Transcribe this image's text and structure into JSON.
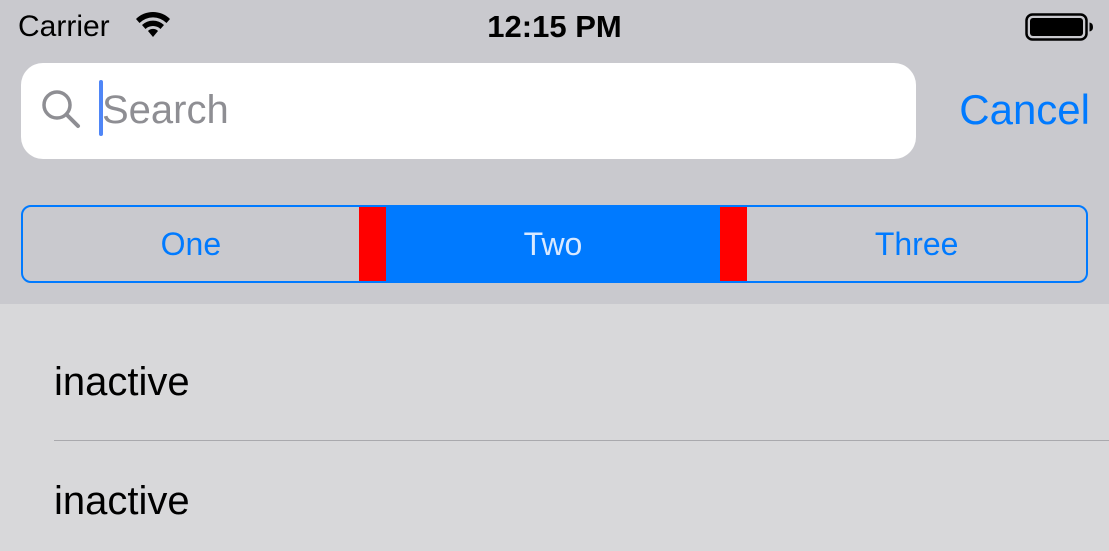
{
  "status_bar": {
    "carrier": "Carrier",
    "time": "12:15 PM",
    "wifi_icon": "wifi-icon",
    "battery_icon": "battery-icon"
  },
  "search": {
    "placeholder": "Search",
    "value": "",
    "cancel_label": "Cancel",
    "icon": "search-icon"
  },
  "segmented_control": {
    "segments": [
      {
        "label": "One",
        "selected": false
      },
      {
        "label": "Two",
        "selected": true
      },
      {
        "label": "Three",
        "selected": false
      }
    ]
  },
  "list": {
    "items": [
      {
        "label": "inactive"
      },
      {
        "label": "inactive"
      }
    ]
  },
  "colors": {
    "accent": "#007aff",
    "highlight": "#ff0000",
    "top_background": "#c9c9ce",
    "list_background": "#d8d8da"
  }
}
